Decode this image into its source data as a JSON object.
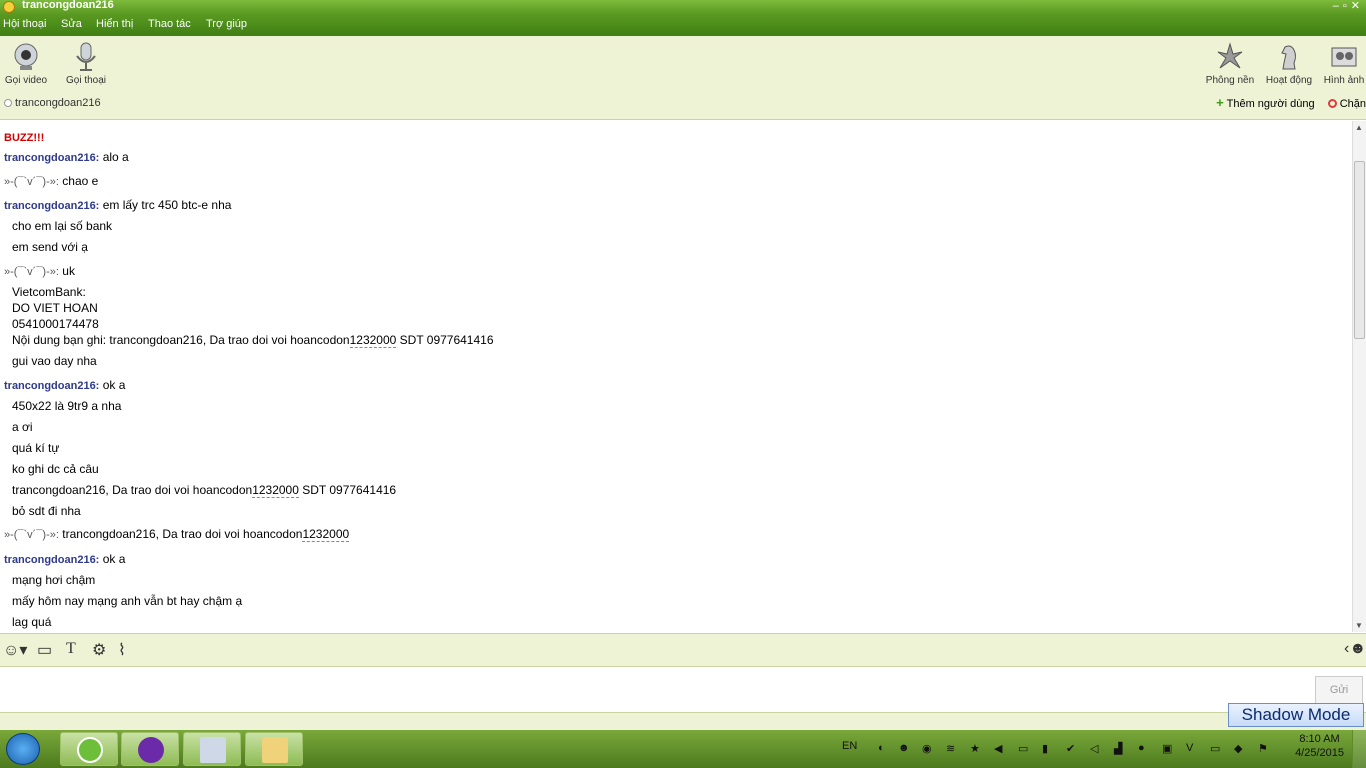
{
  "window": {
    "title": "trancongdoan216"
  },
  "menu": [
    "Hội thoại",
    "Sửa",
    "Hiển thị",
    "Thao tác",
    "Trợ giúp"
  ],
  "toolbar": {
    "left": [
      {
        "label": "Gọi video",
        "icon": "webcam-icon"
      },
      {
        "label": "Gọi thoại",
        "icon": "microphone-icon"
      }
    ],
    "right": [
      {
        "label": "Phông nền",
        "icon": "background-icon"
      },
      {
        "label": "Hoạt động",
        "icon": "chess-knight-icon"
      },
      {
        "label": "Hình ảnh",
        "icon": "photos-icon"
      }
    ],
    "contact": "trancongdoan216",
    "add_user": "Thêm người dùng",
    "block": "Chặn"
  },
  "chat": {
    "buzz": "BUZZ!!!",
    "me_name": "trancongdoan216:",
    "other_name": "»-(¯`v´¯)-»:",
    "lines": {
      "l1": "alo a",
      "l2": "chao e",
      "l3": "em lấy trc 450 btc-e nha",
      "l4": "cho em lại số bank",
      "l5": "em send với ạ",
      "l6": "uk",
      "l7": "VietcomBank:",
      "l8": "DO VIET HOAN",
      "l9": "0541000174478",
      "l10a": "Nội dung bạn ghi: trancongdoan216, Da trao doi voi hoancodon",
      "l10b": "1232000",
      "l10c": " SDT 0977641416",
      "l11": "gui vao day nha",
      "l12": "ok a",
      "l13": "450x22 là 9tr9 a nha",
      "l14": "a ơi",
      "l15": "quá kí tự",
      "l16": "ko ghi dc cả câu",
      "l17a": "trancongdoan216, Da trao doi voi hoancodon",
      "l17b": "1232000",
      "l17c": " SDT 0977641416",
      "l18": "bỏ sdt đi nha",
      "l19a": "trancongdoan216, Da trao doi voi hoancodon",
      "l19b": "1232000",
      "l20": "ok a",
      "l21": "mạng hơi chậm",
      "l22": "mấy hôm nay mạng anh vẫn bt hay chậm ạ",
      "l23": "lag quá"
    }
  },
  "input": {
    "send_label": "Gửi"
  },
  "overlay": {
    "shadow_mode": "Shadow Mode"
  },
  "taskbar": {
    "lang": "EN",
    "time": "8:10 AM",
    "date": "4/25/2015"
  },
  "colors": {
    "frame_green": "#5a9a22",
    "toolbar_bg": "#eef3d5",
    "me_name": "#2e3a8c",
    "buzz": "#d40000"
  }
}
